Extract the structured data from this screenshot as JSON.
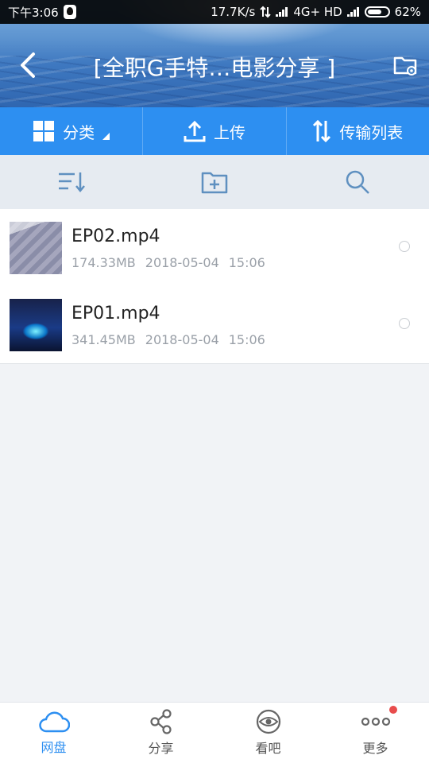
{
  "status_bar": {
    "time": "下午3:06",
    "network_speed": "17.7K/s",
    "network_type": "4G+ HD",
    "battery": "62%"
  },
  "header": {
    "title": "[全职G手特…电影分享 ]"
  },
  "toolbar": {
    "category_label": "分类",
    "upload_label": "上传",
    "transfer_label": "传输列表"
  },
  "files": [
    {
      "name": "EP02.mp4",
      "size": "174.33MB",
      "date": "2018-05-04",
      "time": "15:06"
    },
    {
      "name": "EP01.mp4",
      "size": "341.45MB",
      "date": "2018-05-04",
      "time": "15:06"
    }
  ],
  "bottom_nav": {
    "items": [
      {
        "label": "网盘",
        "icon": "cloud-icon",
        "active": true
      },
      {
        "label": "分享",
        "icon": "share-icon",
        "active": false
      },
      {
        "label": "看吧",
        "icon": "eye-icon",
        "active": false
      },
      {
        "label": "更多",
        "icon": "more-icon",
        "active": false
      }
    ]
  },
  "colors": {
    "accent": "#2d8ff1",
    "notification_dot": "#e84c4c"
  }
}
